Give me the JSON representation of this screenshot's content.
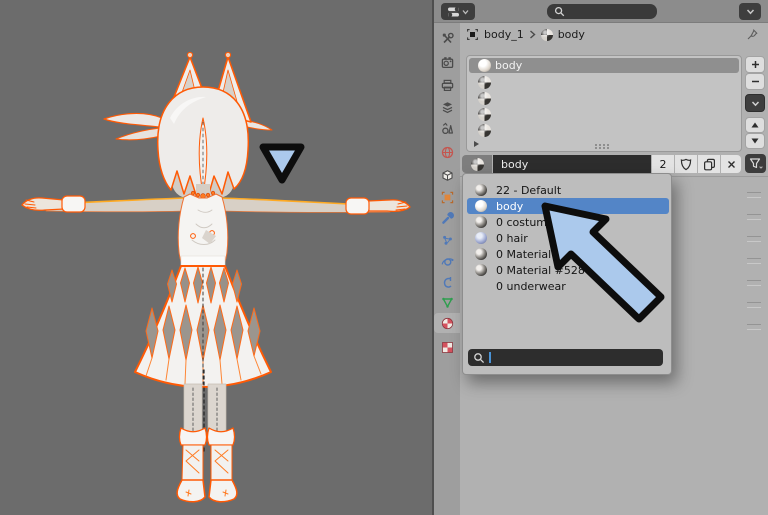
{
  "colors": {
    "viewport_bg": "#6c6c6c",
    "panel_bg": "#b1b1b1",
    "header_bg": "#8c8c8c",
    "tab_column_bg": "#9e9e9e",
    "list_bg": "#c3c3c3",
    "slot_selected_bg": "#8f8f8f",
    "field_dark": "#2d2d2d",
    "button_light": "#e3e3e3",
    "highlight_blue": "#5385c7",
    "annotation_blue": "#abc9ec",
    "annotation_outline": "#0d0d0d",
    "selection_orange": "#ff5a05"
  },
  "header": {
    "search_value": ""
  },
  "breadcrumb": {
    "object_name": "body_1",
    "material_name": "body"
  },
  "tabs": [
    "tool",
    "render",
    "output",
    "view-layer",
    "scene",
    "world",
    "collection",
    "object",
    "modifiers",
    "particles",
    "physics",
    "constraints",
    "object-data",
    "material",
    "texture"
  ],
  "active_tab": "material",
  "material_slots": {
    "selected_name": "body"
  },
  "material_field": {
    "name": "body",
    "users": "2"
  },
  "dropdown": {
    "items": [
      {
        "label": "22 - Default",
        "icon": "material-sphere-dark"
      },
      {
        "label": "body",
        "icon": "material-sphere-light",
        "selected": true
      },
      {
        "label": "0 costume",
        "icon": "material-sphere-dark"
      },
      {
        "label": "0 hair",
        "icon": "material-sphere-blue"
      },
      {
        "label": "0 Material #499",
        "icon": "material-sphere-dark"
      },
      {
        "label": "0 Material #528",
        "icon": "material-sphere-dark"
      },
      {
        "label": "0 underwear",
        "icon": "none"
      }
    ],
    "search_value": ""
  }
}
